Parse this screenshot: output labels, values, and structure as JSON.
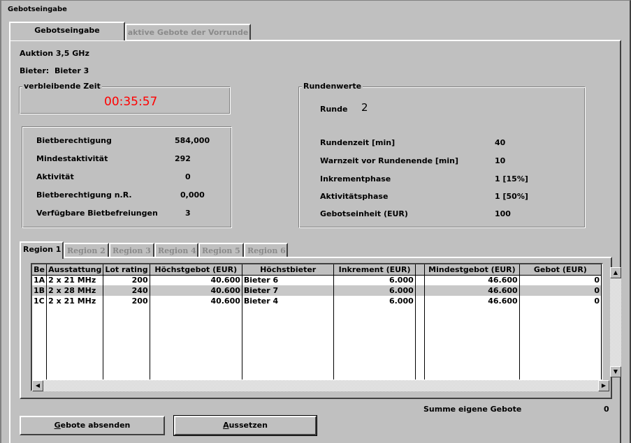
{
  "window": {
    "title": "Gebotseingabe"
  },
  "tabs": [
    {
      "label": "Gebotseingabe",
      "active": true
    },
    {
      "label": "aktive Gebote der Vorrunde",
      "active": false
    }
  ],
  "auction": {
    "name": "Auktion 3,5 GHz",
    "bidder_label": "Bieter:",
    "bidder_value": "Bieter 3"
  },
  "remaining_time": {
    "label": "verbleibende Zeit",
    "value": "00:35:57",
    "color": "#ff0000"
  },
  "eligibility": [
    {
      "label": "Bietberechtigung",
      "value": "584,000"
    },
    {
      "label": "Mindestaktivität",
      "value": "292"
    },
    {
      "label": "Aktivität",
      "value": "0"
    },
    {
      "label": "Bietberechtigung n.R.",
      "value": "0,000"
    },
    {
      "label": "Verfügbare Bietbefreiungen",
      "value": "3"
    }
  ],
  "round": {
    "label": "Rundenwerte",
    "round_label": "Runde",
    "round_value": "2",
    "rows": [
      {
        "label": "Rundenzeit [min]",
        "value": "40"
      },
      {
        "label": "Warnzeit vor Rundenende [min]",
        "value": "10"
      },
      {
        "label": "Inkrementphase",
        "value": "1 [15%]"
      },
      {
        "label": "Aktivitätsphase",
        "value": "1 [50%]"
      },
      {
        "label": "Gebotseinheit (EUR)",
        "value": "100"
      }
    ]
  },
  "region_tabs": [
    {
      "label": "Region 1",
      "active": true
    },
    {
      "label": "Region 2",
      "active": false
    },
    {
      "label": "Region 3",
      "active": false
    },
    {
      "label": "Region 4",
      "active": false
    },
    {
      "label": "Region 5",
      "active": false
    },
    {
      "label": "Region 6",
      "active": false
    }
  ],
  "grid": {
    "columns": [
      "Be",
      "Ausstattung",
      "Lot rating",
      "Höchstgebot (EUR)",
      "Höchstbieter",
      "Inkrement (EUR)",
      "",
      "Mindestgebot (EUR)",
      "Gebot (EUR)"
    ],
    "rows": [
      [
        "1A",
        "2 x 21 MHz",
        "200",
        "40.600",
        "Bieter 6",
        "6.000",
        "",
        "46.600",
        "0"
      ],
      [
        "1B",
        "2 x 28 MHz",
        "240",
        "40.600",
        "Bieter 7",
        "6.000",
        "",
        "46.600",
        "0"
      ],
      [
        "1C",
        "2 x 21 MHz",
        "200",
        "40.600",
        "Bieter 4",
        "6.000",
        "",
        "46.600",
        "0"
      ]
    ]
  },
  "summary": {
    "label": "Summe eigene Gebote",
    "value": "0"
  },
  "buttons": {
    "submit": "Gebote absenden",
    "suspend": "Aussetzen"
  },
  "scroll_icons": {
    "up": "scroll-up-arrow",
    "down": "scroll-down-arrow",
    "left": "scroll-left-arrow",
    "right": "scroll-right-arrow"
  }
}
